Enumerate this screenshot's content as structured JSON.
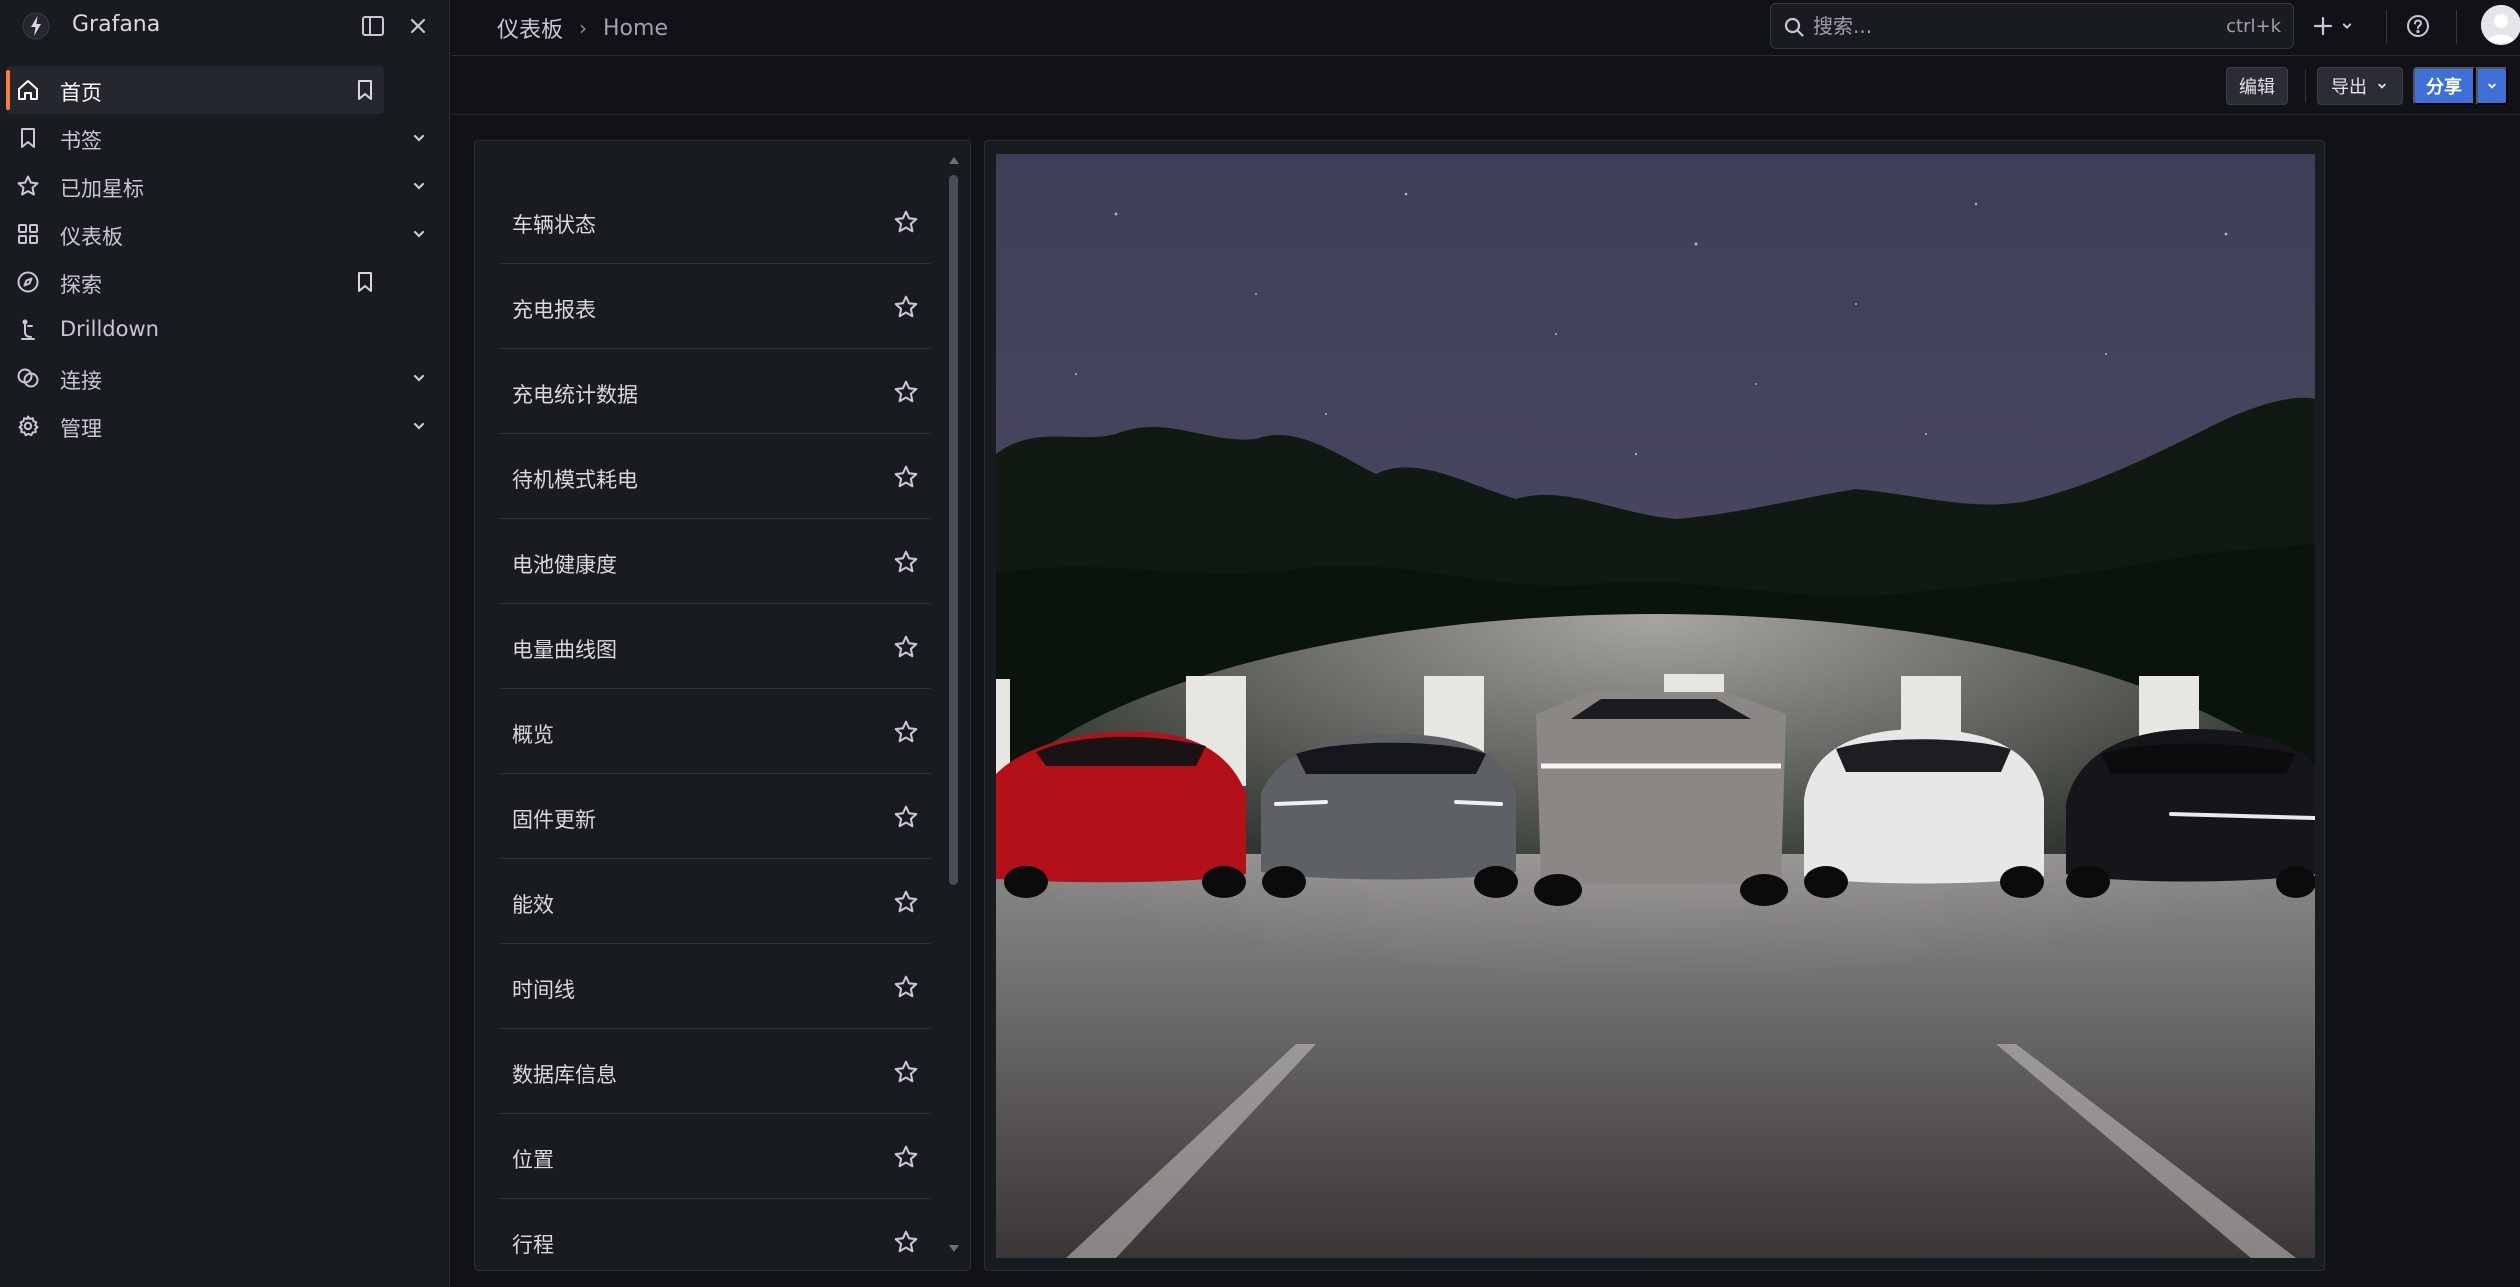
{
  "app": {
    "name": "Grafana"
  },
  "sidebar": {
    "items": [
      {
        "label": "首页",
        "icon": "home-icon",
        "active": true,
        "bookmark": true,
        "expand": false
      },
      {
        "label": "书签",
        "icon": "bookmark-icon",
        "active": false,
        "bookmark": false,
        "expand": true
      },
      {
        "label": "已加星标",
        "icon": "star-icon",
        "active": false,
        "bookmark": false,
        "expand": true
      },
      {
        "label": "仪表板",
        "icon": "apps-icon",
        "active": false,
        "bookmark": false,
        "expand": true
      },
      {
        "label": "探索",
        "icon": "compass-icon",
        "active": false,
        "bookmark": true,
        "expand": false
      },
      {
        "label": "Drilldown",
        "icon": "drilldown-icon",
        "active": false,
        "bookmark": false,
        "expand": false
      },
      {
        "label": "连接",
        "icon": "link-icon",
        "active": false,
        "bookmark": false,
        "expand": true
      },
      {
        "label": "管理",
        "icon": "gear-icon",
        "active": false,
        "bookmark": false,
        "expand": true
      }
    ]
  },
  "topbar": {
    "breadcrumb": {
      "parent": "仪表板",
      "separator": "›",
      "current": "Home"
    },
    "search": {
      "placeholder": "搜索...",
      "shortcut": "ctrl+k"
    }
  },
  "toolbar": {
    "edit_label": "编辑",
    "export_label": "导出",
    "share_label": "分享"
  },
  "dashboard_list": [
    "车辆状态",
    "充电报表",
    "充电统计数据",
    "待机模式耗电",
    "电池健康度",
    "电量曲线图",
    "概览",
    "固件更新",
    "能效",
    "时间线",
    "数据库信息",
    "位置",
    "行程"
  ],
  "colors": {
    "accent": "#ff7941",
    "primary": "#3d71d9",
    "car_red": "#b3101a",
    "car_gray": "#5d6065",
    "car_white": "#e7e7e8",
    "car_black": "#15161a"
  }
}
